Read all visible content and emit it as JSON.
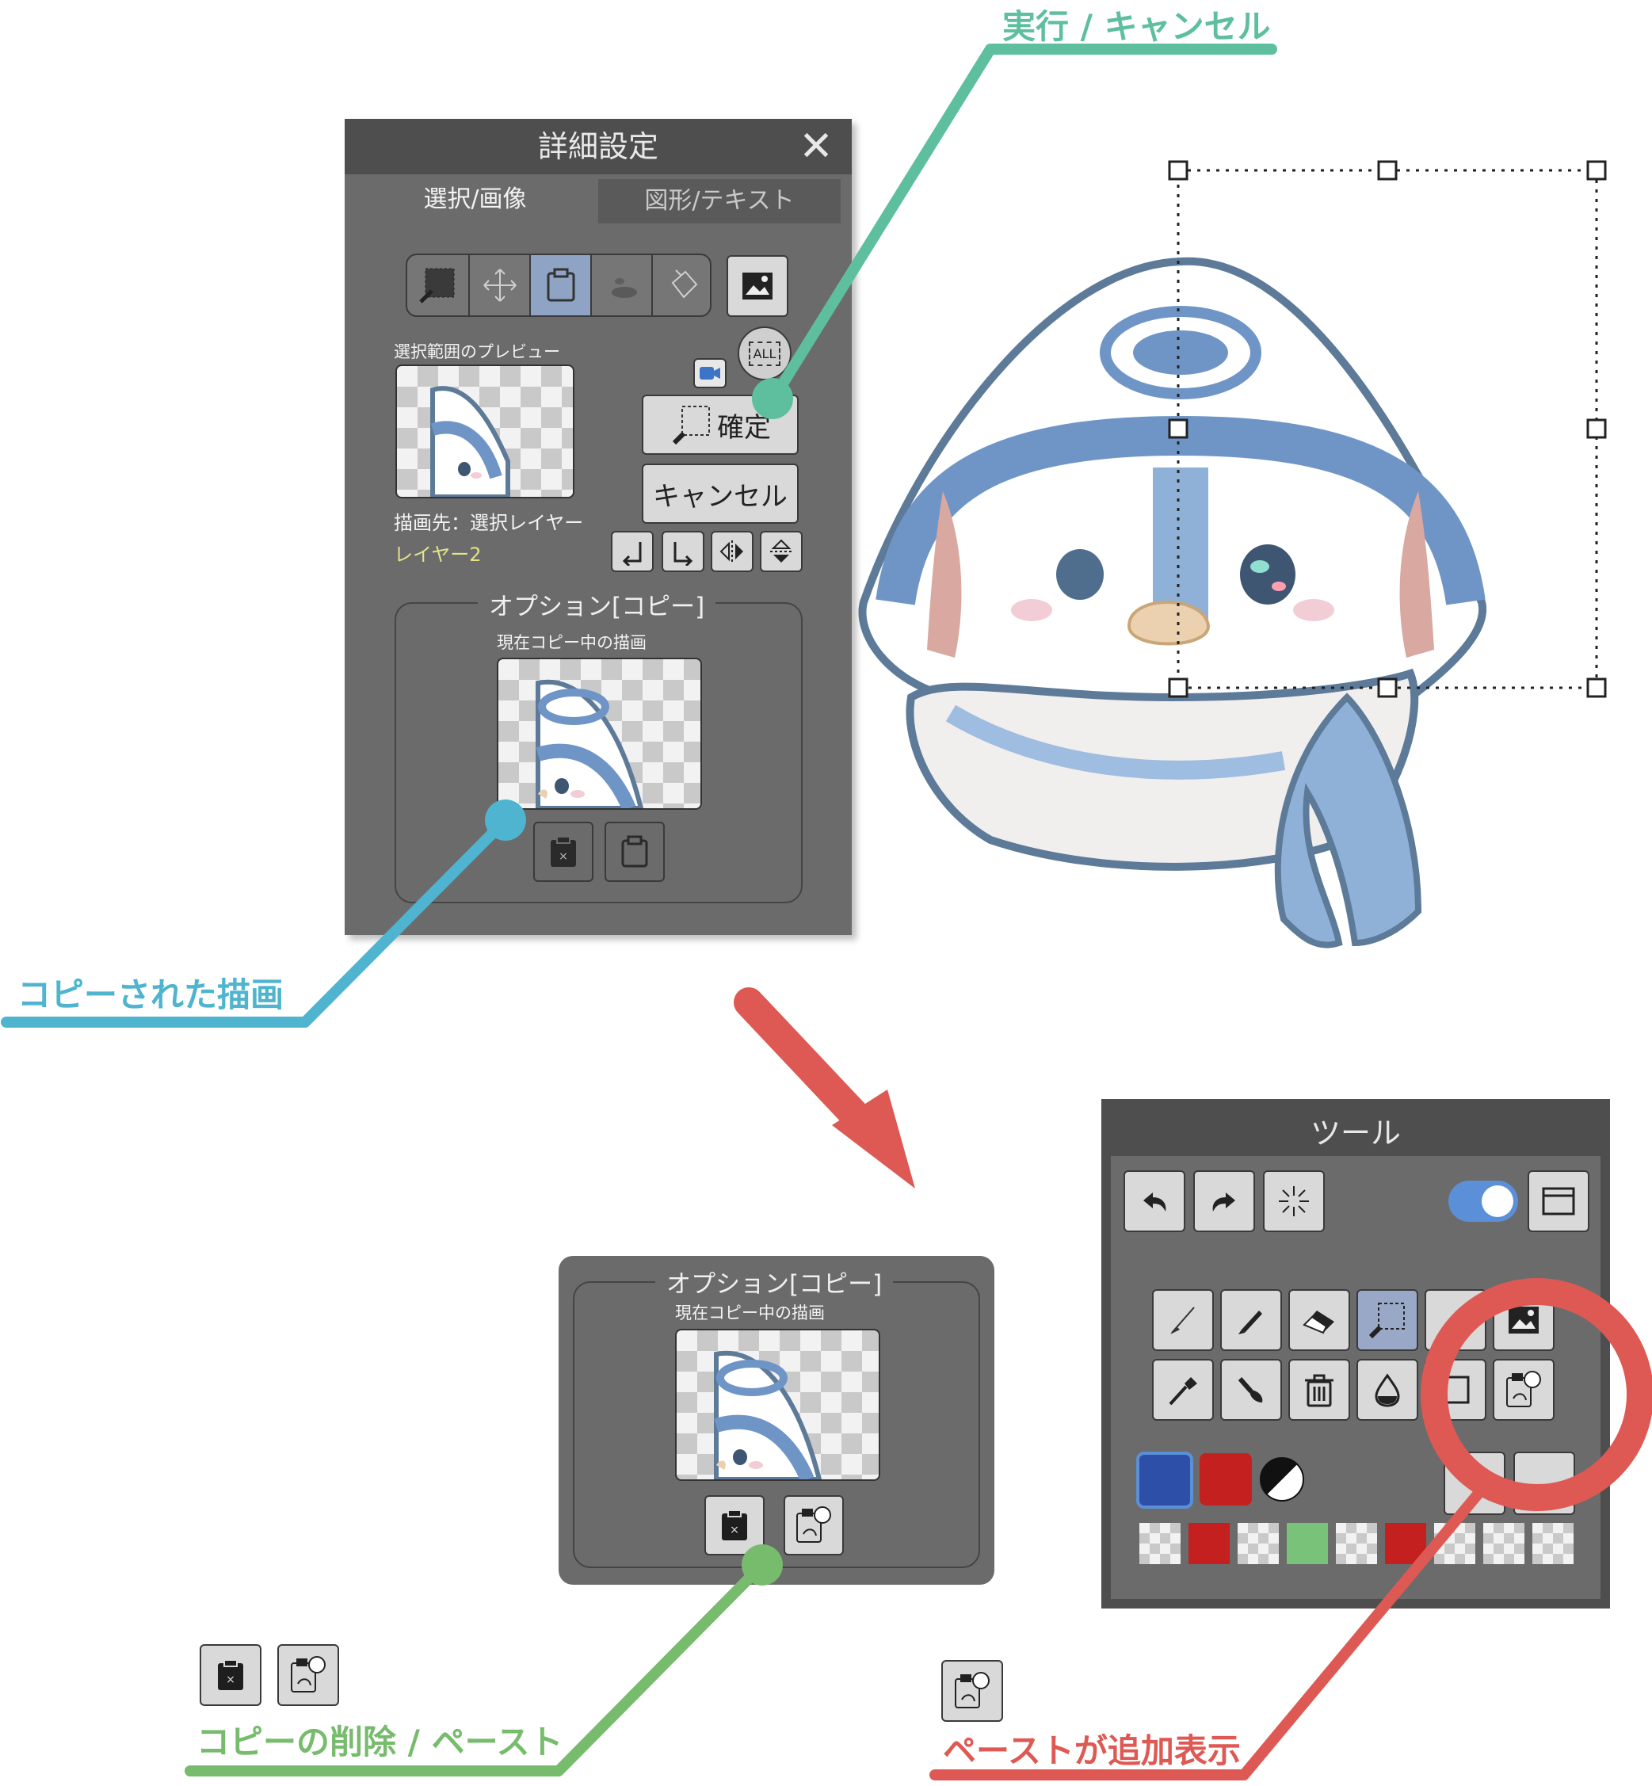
{
  "callouts": {
    "execute_cancel": "実行 / キャンセル",
    "copied_drawing": "コピーされた描画",
    "delete_paste": "コピーの削除 / ペースト",
    "paste_added": "ペーストが追加表示"
  },
  "colors": {
    "teal": "#5ebf9e",
    "blue": "#4fb4cf",
    "green": "#77bb6d",
    "red": "#de5953"
  },
  "detail_panel": {
    "title": "詳細設定",
    "close_icon": "close-icon",
    "tabs": [
      {
        "label": "選択/画像",
        "active": true
      },
      {
        "label": "図形/テキスト",
        "active": false
      }
    ],
    "mode_icons": [
      "selection-icon",
      "move-icon",
      "clipboard-icon",
      "blur-icon",
      "bucket-icon"
    ],
    "image_icon": "image-icon",
    "preview_label": "選択範囲のプレビュー",
    "all_label": "ALL",
    "confirm_label": "確定",
    "cancel_label": "キャンセル",
    "destination_label": "描画先：選択レイヤー",
    "layer_name": "レイヤー2",
    "transform_icons": [
      "rotate-left-icon",
      "rotate-right-icon",
      "flip-horizontal-icon",
      "flip-vertical-icon"
    ],
    "option_title": "オプション[コピー]",
    "current_copy_label": "現在コピー中の描画"
  },
  "option_panel": {
    "title": "オプション[コピー]",
    "current_copy_label": "現在コピー中の描画"
  },
  "tool_panel": {
    "title": "ツール",
    "top_icons": [
      "undo-icon",
      "redo-icon",
      "sparkle-icon"
    ],
    "toggle_on": true,
    "window_icon": "window-icon",
    "tools_row1": [
      "brush-icon",
      "pen-icon",
      "eraser-icon",
      "selection-icon",
      "blank",
      "image-icon"
    ],
    "tools_row2": [
      "eyedropper-icon",
      "smudge-icon",
      "trash-icon",
      "drop-icon",
      "rectangle-icon",
      "paste-icon"
    ],
    "primary_color": "#2e4fa8",
    "secondary_color": "#c42020",
    "palette": [
      "transparent",
      "#c42020",
      "transparent",
      "#79c27a",
      "transparent",
      "#c42020",
      "transparent",
      "transparent",
      "transparent"
    ]
  }
}
